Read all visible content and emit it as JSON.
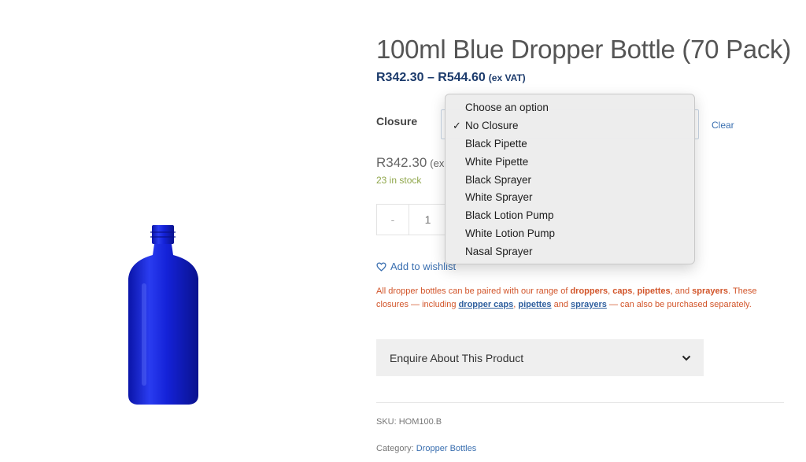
{
  "product": {
    "title": "100ml Blue Dropper Bottle (70 Pack)",
    "price_range": "R342.30 – R544.60",
    "price_range_suffix": "(ex VAT)",
    "price_single": "R342.30",
    "price_single_suffix": "(ex",
    "stock": "23 in stock",
    "quantity_minus": "-",
    "quantity": "1",
    "sku_label": "SKU: HOM100.B",
    "category_label": "Category:",
    "category_link": "Dropper Bottles"
  },
  "variation": {
    "label": "Closure",
    "clear": "Clear",
    "options": [
      {
        "label": "Choose an option",
        "selected": false
      },
      {
        "label": "No Closure",
        "selected": true
      },
      {
        "label": "Black Pipette",
        "selected": false
      },
      {
        "label": "White Pipette",
        "selected": false
      },
      {
        "label": "Black Sprayer",
        "selected": false
      },
      {
        "label": "White Sprayer",
        "selected": false
      },
      {
        "label": "Black Lotion Pump",
        "selected": false
      },
      {
        "label": "White Lotion Pump",
        "selected": false
      },
      {
        "label": "Nasal Sprayer",
        "selected": false
      }
    ],
    "check_glyph": "✓"
  },
  "wishlist": {
    "label": "Add to wishlist",
    "icon": "heart-icon"
  },
  "note": {
    "t1": "All dropper bottles can be paired with our range of ",
    "b1": "droppers",
    "t2": ", ",
    "b2": "caps",
    "t3": ", ",
    "b3": "pipettes",
    "t4": ", and ",
    "b4": "sprayers",
    "t5": ". These closures — including ",
    "l1": "dropper caps",
    "t6": ", ",
    "l2": "pipettes",
    "t7": " and ",
    "l3": "sprayers",
    "t8": " — can also be purchased separately."
  },
  "enquire": {
    "label": "Enquire About This Product",
    "icon": "chevron-down-icon"
  },
  "colors": {
    "price": "#1b3a6b",
    "note_text": "#d2552a",
    "link": "#3a6fb0",
    "stock": "#8fa64a",
    "bottle_blue": "#1a22c8"
  }
}
